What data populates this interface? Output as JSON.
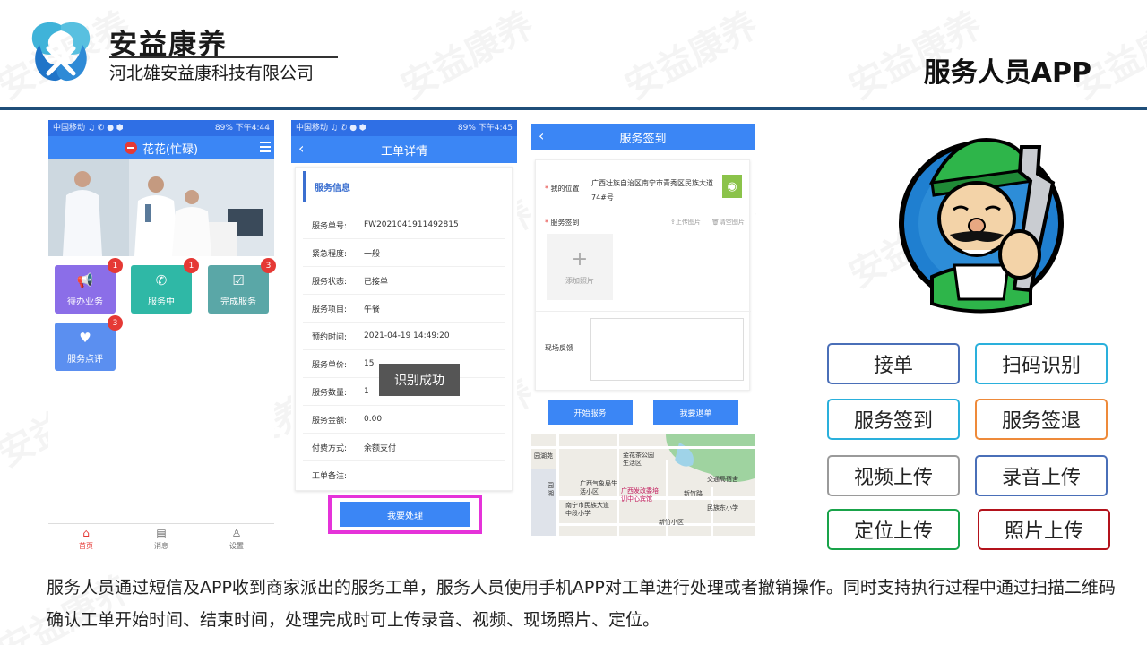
{
  "brand": {
    "name": "安益康养",
    "company": "河北雄安益康科技有限公司",
    "watermark": "安益康养"
  },
  "page_title": "服务人员APP",
  "phone1": {
    "status_left": "中国移动 ♫ ✆ ● ⬢",
    "status_right": "89% 下午4:44",
    "user": "花花(忙碌)",
    "tiles": [
      {
        "label": "待办业务",
        "badge": "1",
        "color": "#8b6ee8"
      },
      {
        "label": "服务中",
        "badge": "1",
        "color": "#2fb8a6"
      },
      {
        "label": "完成服务",
        "badge": "3",
        "color": "#5aa7a7"
      },
      {
        "label": "服务点评",
        "badge": "3",
        "color": "#5b8ff0"
      }
    ],
    "tabs": [
      "首页",
      "消息",
      "设置"
    ]
  },
  "phone2": {
    "status_left": "中国移动 ♫ ✆ ● ⬢",
    "status_right": "89% 下午4:45",
    "title": "工单详情",
    "section": "服务信息",
    "rows": [
      {
        "k": "服务单号:",
        "v": "FW2021041911492815"
      },
      {
        "k": "紧急程度:",
        "v": "一般"
      },
      {
        "k": "服务状态:",
        "v": "已接单"
      },
      {
        "k": "服务项目:",
        "v": "午餐"
      },
      {
        "k": "预约时间:",
        "v": "2021-04-19 14:49:20"
      },
      {
        "k": "服务单价:",
        "v": "15"
      },
      {
        "k": "服务数量:",
        "v": "1"
      },
      {
        "k": "服务金额:",
        "v": "0.00"
      },
      {
        "k": "付费方式:",
        "v": "余额支付"
      },
      {
        "k": "工单备注:",
        "v": ""
      }
    ],
    "toast": "识别成功",
    "action": "我要处理"
  },
  "phone3": {
    "title": "服务签到",
    "location_label": "我的位置",
    "location_value": "广西壮族自治区南宁市青秀区民族大道74#号",
    "checkin_label": "服务签到",
    "upload_photo": "上传图片",
    "clear_photo": "清空图片",
    "add_photo": "添加照片",
    "feedback_label": "现场反馈",
    "btn_start": "开始服务",
    "btn_return": "我要退单",
    "map_labels": [
      "园湖苑",
      "金花茶公园生活区",
      "交通局宿舍",
      "广西气象局生活小区",
      "广西发改委培训中心宾馆",
      "新竹路",
      "南宁市民族大道中段小学",
      "民族东小学",
      "新竹小区",
      "园湖"
    ]
  },
  "features": [
    {
      "label": "接单",
      "color": "#4a6fb8"
    },
    {
      "label": "扫码识别",
      "color": "#2ab0dc"
    },
    {
      "label": "服务签到",
      "color": "#2ab0dc"
    },
    {
      "label": "服务签退",
      "color": "#ee8a3a"
    },
    {
      "label": "视频上传",
      "color": "#9a9a9a"
    },
    {
      "label": "录音上传",
      "color": "#4a6fb8"
    },
    {
      "label": "定位上传",
      "color": "#19a34a"
    },
    {
      "label": "照片上传",
      "color": "#b3121b"
    }
  ],
  "description": "服务人员通过短信及APP收到商家派出的服务工单，服务人员使用手机APP对工单进行处理或者撤销操作。同时支持执行过程中通过扫描二维码确认工单开始时间、结束时间，处理完成时可上传录音、视频、现场照片、定位。"
}
